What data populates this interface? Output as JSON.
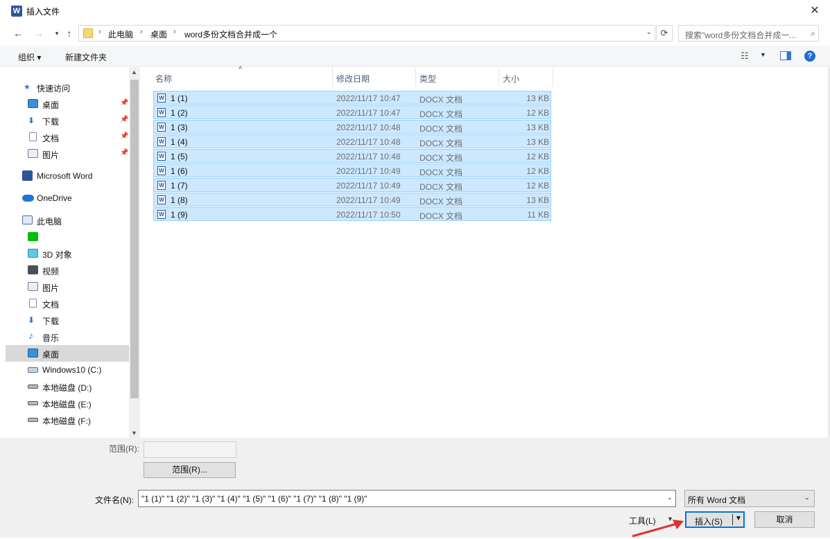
{
  "window": {
    "title": "插入文件",
    "app_icon": "W",
    "close": "✕"
  },
  "address_bar": {
    "crumbs": [
      "此电脑",
      "桌面",
      "word多份文档合并成一个"
    ],
    "search_placeholder": "搜索\"word多份文档合并成一..."
  },
  "toolbar": {
    "organize": "组织 ▾",
    "new_folder": "新建文件夹",
    "help": "?"
  },
  "nav": {
    "items": [
      {
        "label": "快速访问",
        "icon": "star-icon"
      },
      {
        "label": "桌面",
        "icon": "desktop-icon"
      },
      {
        "label": "下载",
        "icon": "download-icon"
      },
      {
        "label": "文档",
        "icon": "document-icon"
      },
      {
        "label": "图片",
        "icon": "pictures-icon"
      },
      {
        "label": "Microsoft Word",
        "icon": "word-icon"
      },
      {
        "label": "OneDrive",
        "icon": "cloud-icon"
      },
      {
        "label": "此电脑",
        "icon": "computer-icon"
      },
      {
        "label": "",
        "icon": "iqiyi-icon"
      },
      {
        "label": "3D 对象",
        "icon": "cube-icon"
      },
      {
        "label": "视频",
        "icon": "video-icon"
      },
      {
        "label": "图片",
        "icon": "pictures-icon"
      },
      {
        "label": "文档",
        "icon": "document-icon"
      },
      {
        "label": "下载",
        "icon": "download-icon"
      },
      {
        "label": "音乐",
        "icon": "music-icon"
      },
      {
        "label": "桌面",
        "icon": "desktop-icon"
      },
      {
        "label": "Windows10 (C:)",
        "icon": "drive-c-icon"
      },
      {
        "label": "本地磁盘 (D:)",
        "icon": "drive-icon"
      },
      {
        "label": "本地磁盘 (E:)",
        "icon": "drive-icon"
      },
      {
        "label": "本地磁盘 (F:)",
        "icon": "drive-icon"
      }
    ]
  },
  "columns": {
    "name": "名称",
    "date": "修改日期",
    "type": "类型",
    "size": "大小"
  },
  "files": [
    {
      "name": "1 (1)",
      "date": "2022/11/17 10:47",
      "type": "DOCX 文档",
      "size": "13 KB"
    },
    {
      "name": "1 (2)",
      "date": "2022/11/17 10:47",
      "type": "DOCX 文档",
      "size": "12 KB"
    },
    {
      "name": "1 (3)",
      "date": "2022/11/17 10:48",
      "type": "DOCX 文档",
      "size": "13 KB"
    },
    {
      "name": "1 (4)",
      "date": "2022/11/17 10:48",
      "type": "DOCX 文档",
      "size": "13 KB"
    },
    {
      "name": "1 (5)",
      "date": "2022/11/17 10:48",
      "type": "DOCX 文档",
      "size": "12 KB"
    },
    {
      "name": "1 (6)",
      "date": "2022/11/17 10:49",
      "type": "DOCX 文档",
      "size": "12 KB"
    },
    {
      "name": "1 (7)",
      "date": "2022/11/17 10:49",
      "type": "DOCX 文档",
      "size": "12 KB"
    },
    {
      "name": "1 (8)",
      "date": "2022/11/17 10:49",
      "type": "DOCX 文档",
      "size": "13 KB"
    },
    {
      "name": "1 (9)",
      "date": "2022/11/17 10:50",
      "type": "DOCX 文档",
      "size": "11 KB"
    }
  ],
  "bottom": {
    "range_label": "范围(R):",
    "range_value": "",
    "range_button": "范围(R)...",
    "filename_label": "文件名(N):",
    "filename_value": "\"1 (1)\" \"1 (2)\" \"1 (3)\" \"1 (4)\" \"1 (5)\" \"1 (6)\" \"1 (7)\" \"1 (8)\" \"1 (9)\"",
    "filetype_value": "所有 Word 文档",
    "tools_label": "工具(L)",
    "insert_label": "插入(S)",
    "cancel_label": "取消"
  },
  "colors": {
    "selection_bg": "#cce8ff",
    "selection_border": "#99d1ff",
    "accent": "#0078d7",
    "annotation_arrow": "#e03030"
  }
}
